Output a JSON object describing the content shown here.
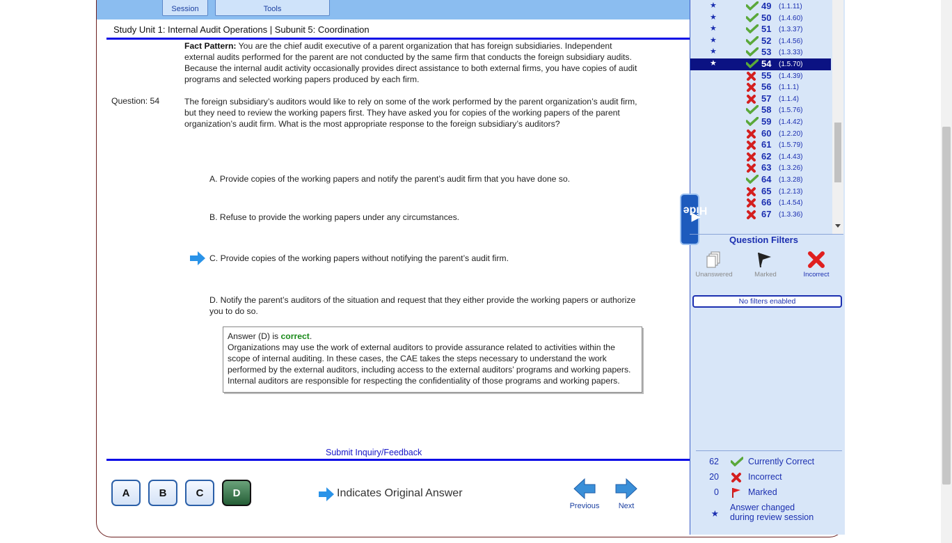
{
  "toolbar": {
    "session_label": "Session",
    "tools_label": "Tools"
  },
  "breadcrumb": "Study Unit 1: Internal Audit Operations | Subunit 5: Coordination",
  "fact_pattern": {
    "label": "Fact Pattern:",
    "text": "You are the chief audit executive of a parent organization that has foreign subsidiaries. Independent external audits performed for the parent are not conducted by the same firm that conducts the foreign subsidiary audits. Because the internal audit activity occasionally provides direct assistance to both external firms, you have copies of audit programs and selected working papers produced by each firm."
  },
  "question": {
    "label": "Question: 54",
    "text": "The foreign subsidiary’s auditors would like to rely on some of the work performed by the parent organization’s audit firm, but they need to review the working papers first. They have asked you for copies of the working papers of the parent organization’s audit firm. What is the most appropriate response to the foreign subsidiary’s auditors?"
  },
  "choices": [
    {
      "letter": "A.",
      "text": "Provide copies of the working papers and notify the parent’s audit firm that you have done so."
    },
    {
      "letter": "B.",
      "text": "Refuse to provide the working papers under any circumstances."
    },
    {
      "letter": "C.",
      "text": "Provide copies of the working papers without notifying the parent’s audit firm."
    },
    {
      "letter": "D.",
      "text": "Notify the parent’s auditors of the situation and request that they either provide the working papers or authorize you to do so."
    }
  ],
  "answer": {
    "prefix": "Answer (D) is",
    "status": "correct",
    "explanation": "Organizations may use the work of external auditors to provide assurance related to activities within the scope of internal auditing. In these cases, the CAE takes the steps necessary to understand the work performed by the external auditors, including access to the external auditors’ programs and working papers. Internal auditors are responsible for respecting the confidentiality of those programs and working papers."
  },
  "inquiry_link": "Submit Inquiry/Feedback",
  "answer_buttons": [
    "A",
    "B",
    "C",
    "D"
  ],
  "selected_answer": "D",
  "legend_original": "Indicates Original Answer",
  "nav": {
    "previous": "Previous",
    "next": "Next"
  },
  "hide_tab": "Hide",
  "question_list": [
    {
      "num": "49",
      "ref": "(1.1.11)",
      "status": "correct",
      "star": true
    },
    {
      "num": "50",
      "ref": "(1.4.60)",
      "status": "correct",
      "star": true
    },
    {
      "num": "51",
      "ref": "(1.3.37)",
      "status": "correct",
      "star": true
    },
    {
      "num": "52",
      "ref": "(1.4.56)",
      "status": "correct",
      "star": true
    },
    {
      "num": "53",
      "ref": "(1.3.33)",
      "status": "correct",
      "star": true
    },
    {
      "num": "54",
      "ref": "(1.5.70)",
      "status": "correct",
      "star": true,
      "active": true
    },
    {
      "num": "55",
      "ref": "(1.4.39)",
      "status": "incorrect"
    },
    {
      "num": "56",
      "ref": "(1.1.1)",
      "status": "incorrect"
    },
    {
      "num": "57",
      "ref": "(1.1.4)",
      "status": "incorrect"
    },
    {
      "num": "58",
      "ref": "(1.5.76)",
      "status": "correct"
    },
    {
      "num": "59",
      "ref": "(1.4.42)",
      "status": "correct"
    },
    {
      "num": "60",
      "ref": "(1.2.20)",
      "status": "incorrect"
    },
    {
      "num": "61",
      "ref": "(1.5.79)",
      "status": "incorrect"
    },
    {
      "num": "62",
      "ref": "(1.4.43)",
      "status": "incorrect"
    },
    {
      "num": "63",
      "ref": "(1.3.26)",
      "status": "incorrect"
    },
    {
      "num": "64",
      "ref": "(1.3.28)",
      "status": "correct"
    },
    {
      "num": "65",
      "ref": "(1.2.13)",
      "status": "incorrect"
    },
    {
      "num": "66",
      "ref": "(1.4.54)",
      "status": "incorrect"
    },
    {
      "num": "67",
      "ref": "(1.3.36)",
      "status": "incorrect"
    }
  ],
  "filters": {
    "title": "Question Filters",
    "unanswered": "Unanswered",
    "marked": "Marked",
    "incorrect": "Incorrect",
    "status": "No filters enabled"
  },
  "stats": {
    "correct_count": "62",
    "correct_label": "Currently Correct",
    "incorrect_count": "20",
    "incorrect_label": "Incorrect",
    "marked_count": "0",
    "marked_label": "Marked",
    "changed_label_1": "Answer changed",
    "changed_label_2": "during review session"
  },
  "colors": {
    "accent": "#0a0ae6",
    "correct": "#5aa83a",
    "incorrect": "#d41f1f",
    "sidebar": "#d8e6f8"
  }
}
